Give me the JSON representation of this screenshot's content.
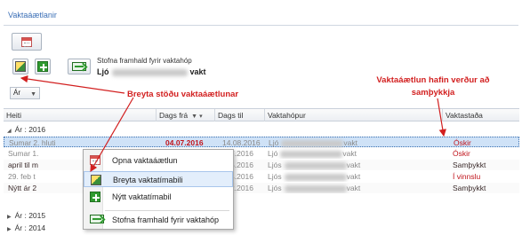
{
  "header": {
    "title": "Vaktaáætlanir"
  },
  "toolbar": {
    "calendar_icon": "calendar-icon",
    "status_icon": "pencil-edit-icon",
    "new_icon": "green-plus-icon",
    "continue_icon": "continue-arrow-icon"
  },
  "team": {
    "label": "Stofna framhald fyrir vaktahóp",
    "name_prefix": "Ljó",
    "name_suffix": "vakt"
  },
  "annotations": {
    "left": "Breyta stöðu vaktaáætlunar",
    "right_line1": "Vaktaáætlun hafin verður að",
    "right_line2": "samþykkja"
  },
  "grouping": {
    "value": "Ár"
  },
  "grid": {
    "columns": {
      "heiti": "Heiti",
      "from": "Dags frá",
      "to": "Dags til",
      "hopur": "Vaktahópur",
      "stada": "Vaktastaða"
    },
    "group_2016": "Ár : 2016",
    "group_2015": "Ár : 2015",
    "group_2014": "Ár : 2014",
    "rows": [
      {
        "heiti": "Sumar 2. hluti",
        "from": "04.07.2016",
        "to": "14.08.2016",
        "hop_prefix": "Ljó",
        "hop_suffix": "vakt",
        "state": "Óskir"
      },
      {
        "heiti": "Sumar 1.",
        "from": "",
        "to": "7.2016",
        "hop_prefix": "Ljó",
        "hop_suffix": "vakt",
        "state": "Óskir"
      },
      {
        "heiti": "april til m",
        "from": "",
        "to": "5.2016",
        "hop_prefix": "Ljós",
        "hop_suffix": "vakt",
        "state": "Samþykkt"
      },
      {
        "heiti": "29. feb t",
        "from": "",
        "to": "4.2016",
        "hop_prefix": "Ljós",
        "hop_suffix": "vakt",
        "state": "Í vinnslu"
      },
      {
        "heiti": "Nýtt ár 2",
        "from": "",
        "to": "2.2016",
        "hop_prefix": "Ljós",
        "hop_suffix": "vakt",
        "state": "Samþykkt"
      }
    ]
  },
  "context_menu": {
    "open": "Opna vaktaáætlun",
    "edit": "Breyta vaktatímabili",
    "new": "Nýtt vaktatímabil",
    "continue": "Stofna framhald fyrir vaktahóp"
  },
  "colors": {
    "accent": "#3b6fb6",
    "annotation": "#d21f1f",
    "status_red": "#c0141c"
  }
}
